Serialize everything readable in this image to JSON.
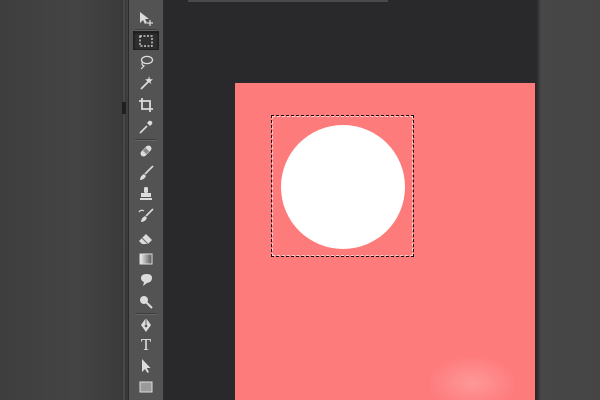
{
  "app": {
    "accent_color": "#fe7b7c"
  },
  "toolbar": {
    "tools": [
      {
        "id": "move",
        "icon": "move-tool-icon",
        "active": false
      },
      {
        "id": "rectangular-marquee",
        "icon": "rectangular-marquee-icon",
        "active": true
      },
      {
        "id": "lasso",
        "icon": "lasso-icon",
        "active": false
      },
      {
        "id": "magic-wand",
        "icon": "magic-wand-icon",
        "active": false
      },
      {
        "id": "crop",
        "icon": "crop-icon",
        "active": false
      },
      {
        "id": "eyedropper",
        "icon": "eyedropper-icon",
        "active": false
      },
      {
        "id": "healing-brush",
        "icon": "bandage-icon",
        "active": false
      },
      {
        "id": "brush",
        "icon": "brush-icon",
        "active": false
      },
      {
        "id": "clone-stamp",
        "icon": "stamp-icon",
        "active": false
      },
      {
        "id": "history-brush",
        "icon": "history-brush-icon",
        "active": false
      },
      {
        "id": "eraser",
        "icon": "eraser-icon",
        "active": false
      },
      {
        "id": "gradient",
        "icon": "gradient-icon",
        "active": false
      },
      {
        "id": "blur",
        "icon": "blur-drop-icon",
        "active": false
      },
      {
        "id": "dodge",
        "icon": "dodge-icon",
        "active": false
      },
      {
        "id": "pen",
        "icon": "pen-icon",
        "active": false
      },
      {
        "id": "type",
        "icon": "type-icon",
        "label": "T",
        "active": false
      },
      {
        "id": "path-selection",
        "icon": "path-selection-arrow-icon",
        "active": false
      },
      {
        "id": "rectangle-shape",
        "icon": "rectangle-shape-icon",
        "active": false
      }
    ]
  },
  "document": {
    "canvas_color": "#fe7b7c",
    "shape_color": "#ffffff",
    "shape": "circle"
  }
}
